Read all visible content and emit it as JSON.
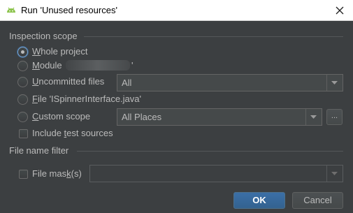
{
  "window": {
    "title": "Run 'Unused resources'",
    "icon": "android-icon",
    "close_icon": "close-icon"
  },
  "inspection_scope": {
    "header": "Inspection scope",
    "options": [
      {
        "label_pre": "",
        "mnemonic": "W",
        "label_post": "hole project",
        "checked": true
      },
      {
        "label_pre": "",
        "mnemonic": "M",
        "label_post": "odule",
        "suffix": "'",
        "checked": false
      },
      {
        "label_pre": "",
        "mnemonic": "U",
        "label_post": "ncommitted files",
        "checked": false
      },
      {
        "label_pre": "",
        "mnemonic": "F",
        "label_post": "ile 'ISpinnerInterface.java'",
        "checked": false
      },
      {
        "label_pre": "",
        "mnemonic": "C",
        "label_post": "ustom scope",
        "checked": false
      }
    ],
    "uncommitted_select": "All",
    "custom_scope_select": "All Places",
    "ellipsis": "...",
    "include_tests": {
      "label_pre": "Include ",
      "mnemonic": "t",
      "label_post": "est sources",
      "checked": false
    }
  },
  "file_name_filter": {
    "header": "File name filter",
    "file_mask": {
      "label_pre": "File mas",
      "mnemonic": "k",
      "label_post": "(s)",
      "checked": false
    },
    "mask_value": ""
  },
  "buttons": {
    "ok": "OK",
    "cancel": "Cancel"
  },
  "colors": {
    "background": "#3c3f41",
    "text": "#bbbbbb",
    "ok_button": "#365880"
  }
}
